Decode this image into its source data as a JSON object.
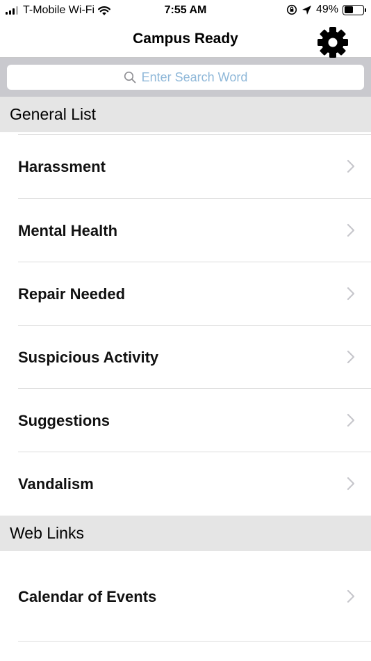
{
  "status_bar": {
    "carrier": "T-Mobile Wi-Fi",
    "time": "7:55 AM",
    "battery": "49%",
    "battery_level": 0.49
  },
  "nav": {
    "title": "Campus Ready",
    "settings_icon": "gear-icon"
  },
  "search": {
    "placeholder": "Enter Search Word"
  },
  "sections": {
    "general": {
      "title": "General List",
      "items": [
        {
          "label": "Harassment"
        },
        {
          "label": "Mental Health"
        },
        {
          "label": "Repair Needed"
        },
        {
          "label": "Suspicious Activity"
        },
        {
          "label": "Suggestions"
        },
        {
          "label": "Vandalism"
        }
      ]
    },
    "web_links": {
      "title": "Web Links",
      "items": [
        {
          "label": "Calendar of Events"
        }
      ]
    }
  },
  "colors": {
    "search_background": "#c9c9ce",
    "section_header_background": "#e5e5e5",
    "placeholder_text": "#8fb8d9",
    "chevron": "#c7c7cc"
  }
}
